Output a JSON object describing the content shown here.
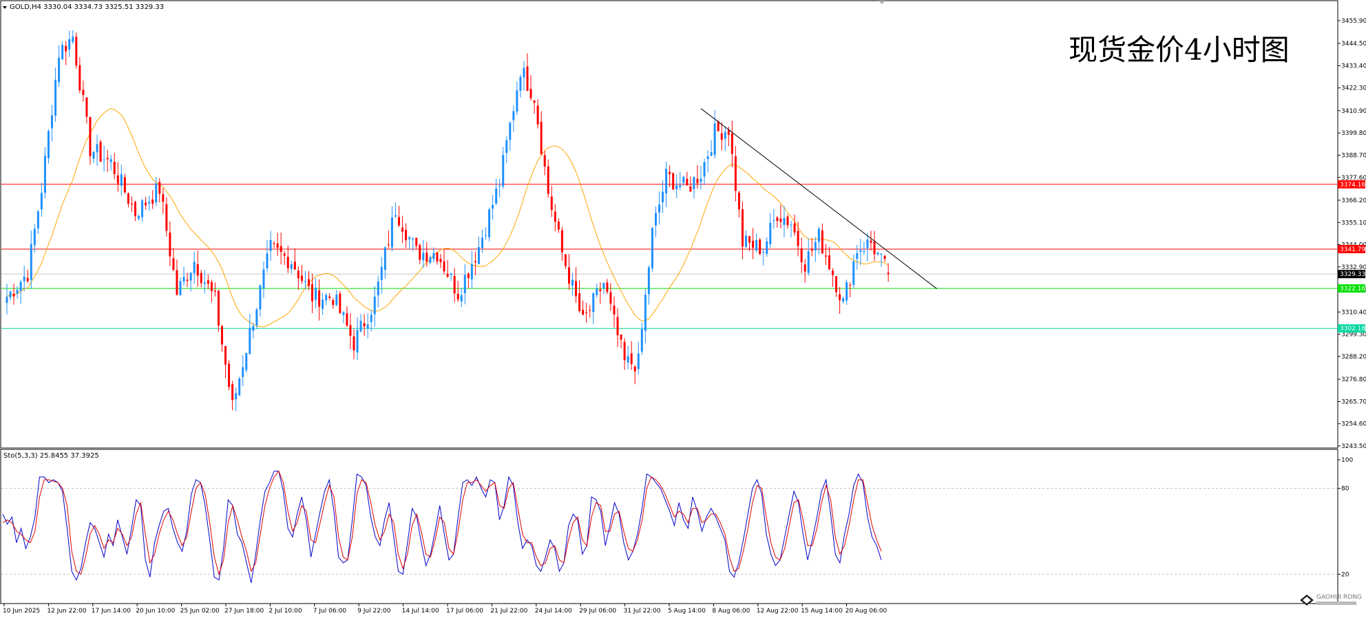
{
  "chart_data": [
    {
      "type": "candlestick",
      "symbol_header": "GOLD,H4  3330.04 3334.73 3325.51 3329.33",
      "title": "现货金价4小时图",
      "ohlc_last": {
        "open": 3330.04,
        "high": 3334.73,
        "low": 3325.51,
        "close": 3329.33
      },
      "ylim": [
        3243.5,
        3460.0
      ],
      "y_ticks": [
        "3455.90",
        "3444.50",
        "3433.40",
        "3422.30",
        "3410.90",
        "3399.80",
        "3388.70",
        "3377.60",
        "3366.20",
        "3355.10",
        "3344.00",
        "3332.90",
        "3321.50",
        "3310.40",
        "3299.30",
        "3288.20",
        "3276.80",
        "3265.70",
        "3254.60",
        "3243.50"
      ],
      "x_ticks": [
        "10 Jun 2025",
        "12 Jun 22:00",
        "17 Jun 14:00",
        "20 Jun 10:00",
        "25 Jun 02:00",
        "27 Jun 18:00",
        "2 Jul 10:00",
        "7 Jul 06:00",
        "9 Jul 22:00",
        "14 Jul 14:00",
        "17 Jul 06:00",
        "21 Jul 22:00",
        "24 Jul 14:00",
        "29 Jul 06:00",
        "31 Jul 22:00",
        "5 Aug 14:00",
        "8 Aug 06:00",
        "12 Aug 22:00",
        "15 Aug 14:00",
        "20 Aug 06:00"
      ],
      "horizontal_levels": [
        {
          "value": 3374.16,
          "label": "3374.16",
          "color": "#ff0000"
        },
        {
          "value": 3341.79,
          "label": "3341.79",
          "color": "#ff0000"
        },
        {
          "value": 3322.16,
          "label": "3322.16",
          "color": "#00e000"
        },
        {
          "value": 3302.18,
          "label": "3302.18",
          "color": "#00d6a0"
        }
      ],
      "current_price": {
        "value": 3329.33,
        "label": "3329.33"
      },
      "trendline": {
        "from": {
          "x": 200,
          "y": 3412.0
        },
        "to": {
          "x": 268,
          "y": 3322.0
        }
      },
      "moving_average_color": "#ffa500",
      "up_color": "#1e90ff",
      "down_color": "#ff0000",
      "key_points": [
        {
          "x": 0,
          "y": 3318
        },
        {
          "x": 6,
          "y": 3330
        },
        {
          "x": 10,
          "y": 3372
        },
        {
          "x": 15,
          "y": 3440
        },
        {
          "x": 19,
          "y": 3448
        },
        {
          "x": 24,
          "y": 3392
        },
        {
          "x": 30,
          "y": 3385
        },
        {
          "x": 37,
          "y": 3360
        },
        {
          "x": 44,
          "y": 3372
        },
        {
          "x": 49,
          "y": 3320
        },
        {
          "x": 54,
          "y": 3336
        },
        {
          "x": 60,
          "y": 3316
        },
        {
          "x": 65,
          "y": 3263
        },
        {
          "x": 70,
          "y": 3300
        },
        {
          "x": 76,
          "y": 3342
        },
        {
          "x": 82,
          "y": 3336
        },
        {
          "x": 88,
          "y": 3318
        },
        {
          "x": 94,
          "y": 3318
        },
        {
          "x": 100,
          "y": 3295
        },
        {
          "x": 106,
          "y": 3316
        },
        {
          "x": 112,
          "y": 3362
        },
        {
          "x": 118,
          "y": 3340
        },
        {
          "x": 124,
          "y": 3340
        },
        {
          "x": 130,
          "y": 3320
        },
        {
          "x": 136,
          "y": 3343
        },
        {
          "x": 142,
          "y": 3375
        },
        {
          "x": 148,
          "y": 3432
        },
        {
          "x": 152,
          "y": 3418
        },
        {
          "x": 156,
          "y": 3370
        },
        {
          "x": 160,
          "y": 3340
        },
        {
          "x": 166,
          "y": 3305
        },
        {
          "x": 172,
          "y": 3325
        },
        {
          "x": 178,
          "y": 3285
        },
        {
          "x": 182,
          "y": 3285
        },
        {
          "x": 186,
          "y": 3350
        },
        {
          "x": 190,
          "y": 3378
        },
        {
          "x": 196,
          "y": 3372
        },
        {
          "x": 200,
          "y": 3380
        },
        {
          "x": 204,
          "y": 3400
        },
        {
          "x": 208,
          "y": 3402
        },
        {
          "x": 212,
          "y": 3345
        },
        {
          "x": 218,
          "y": 3342
        },
        {
          "x": 222,
          "y": 3360
        },
        {
          "x": 226,
          "y": 3355
        },
        {
          "x": 230,
          "y": 3335
        },
        {
          "x": 234,
          "y": 3348
        },
        {
          "x": 238,
          "y": 3330
        },
        {
          "x": 241,
          "y": 3315
        },
        {
          "x": 245,
          "y": 3342
        },
        {
          "x": 249,
          "y": 3345
        },
        {
          "x": 254,
          "y": 3329.33
        }
      ],
      "xlim": [
        0,
        385
      ]
    },
    {
      "type": "line",
      "header": "Sto(5,3,3) 25.8455 37.3925",
      "ylim": [
        0,
        100
      ],
      "y_ticks": [
        "100",
        "80",
        "20"
      ],
      "levels": [
        80,
        20
      ],
      "series_colors": [
        "#0000cc",
        "#dd0000"
      ],
      "main_values": [
        62,
        55,
        60,
        42,
        52,
        38,
        46,
        60,
        88,
        88,
        84,
        86,
        84,
        78,
        52,
        22,
        16,
        24,
        42,
        56,
        52,
        42,
        32,
        48,
        40,
        58,
        46,
        34,
        52,
        72,
        68,
        30,
        18,
        42,
        54,
        64,
        66,
        52,
        42,
        36,
        50,
        76,
        86,
        84,
        68,
        44,
        18,
        16,
        38,
        72,
        68,
        48,
        42,
        28,
        14,
        34,
        58,
        78,
        84,
        92,
        92,
        78,
        52,
        46,
        62,
        74,
        58,
        32,
        48,
        64,
        78,
        86,
        64,
        32,
        28,
        30,
        58,
        90,
        88,
        82,
        60,
        46,
        40,
        58,
        70,
        46,
        22,
        20,
        42,
        66,
        60,
        42,
        26,
        34,
        50,
        68,
        48,
        30,
        34,
        60,
        84,
        86,
        82,
        88,
        80,
        74,
        86,
        84,
        58,
        68,
        88,
        82,
        56,
        38,
        44,
        40,
        26,
        22,
        32,
        44,
        38,
        22,
        28,
        54,
        62,
        58,
        34,
        40,
        74,
        72,
        64,
        40,
        54,
        70,
        62,
        42,
        30,
        36,
        48,
        66,
        90,
        88,
        84,
        80,
        72,
        64,
        54,
        70,
        58,
        52,
        74,
        64,
        50,
        60,
        66,
        60,
        52,
        44,
        22,
        18,
        28,
        44,
        62,
        80,
        86,
        76,
        48,
        34,
        26,
        30,
        46,
        62,
        78,
        70,
        48,
        30,
        44,
        60,
        78,
        86,
        62,
        34,
        28,
        48,
        62,
        82,
        90,
        84,
        60,
        46,
        40,
        30
      ],
      "signal_values": [
        56,
        58,
        56,
        50,
        48,
        44,
        42,
        50,
        74,
        86,
        86,
        85,
        84,
        80,
        68,
        36,
        22,
        20,
        32,
        48,
        54,
        48,
        38,
        44,
        42,
        52,
        48,
        40,
        46,
        62,
        70,
        48,
        28,
        34,
        48,
        58,
        64,
        58,
        48,
        40,
        46,
        64,
        80,
        84,
        76,
        56,
        32,
        20,
        30,
        56,
        68,
        58,
        46,
        36,
        22,
        28,
        48,
        68,
        80,
        88,
        92,
        84,
        64,
        50,
        56,
        68,
        64,
        44,
        42,
        56,
        70,
        82,
        74,
        46,
        32,
        30,
        46,
        76,
        86,
        84,
        70,
        54,
        44,
        50,
        62,
        56,
        34,
        24,
        34,
        54,
        62,
        50,
        34,
        32,
        44,
        60,
        56,
        38,
        34,
        50,
        72,
        84,
        84,
        86,
        82,
        78,
        82,
        84,
        68,
        66,
        80,
        84,
        66,
        48,
        42,
        42,
        32,
        26,
        28,
        38,
        40,
        30,
        28,
        44,
        56,
        60,
        44,
        40,
        60,
        70,
        68,
        50,
        50,
        62,
        64,
        50,
        38,
        36,
        44,
        58,
        80,
        88,
        86,
        82,
        76,
        68,
        60,
        64,
        62,
        56,
        66,
        66,
        56,
        58,
        62,
        62,
        56,
        48,
        32,
        22,
        24,
        36,
        52,
        70,
        82,
        80,
        60,
        42,
        32,
        30,
        38,
        54,
        70,
        72,
        58,
        40,
        40,
        52,
        70,
        82,
        72,
        46,
        34,
        40,
        54,
        72,
        86,
        86,
        70,
        54,
        44,
        36
      ]
    }
  ],
  "watermark": {
    "text": "GAOHUI RONG"
  }
}
